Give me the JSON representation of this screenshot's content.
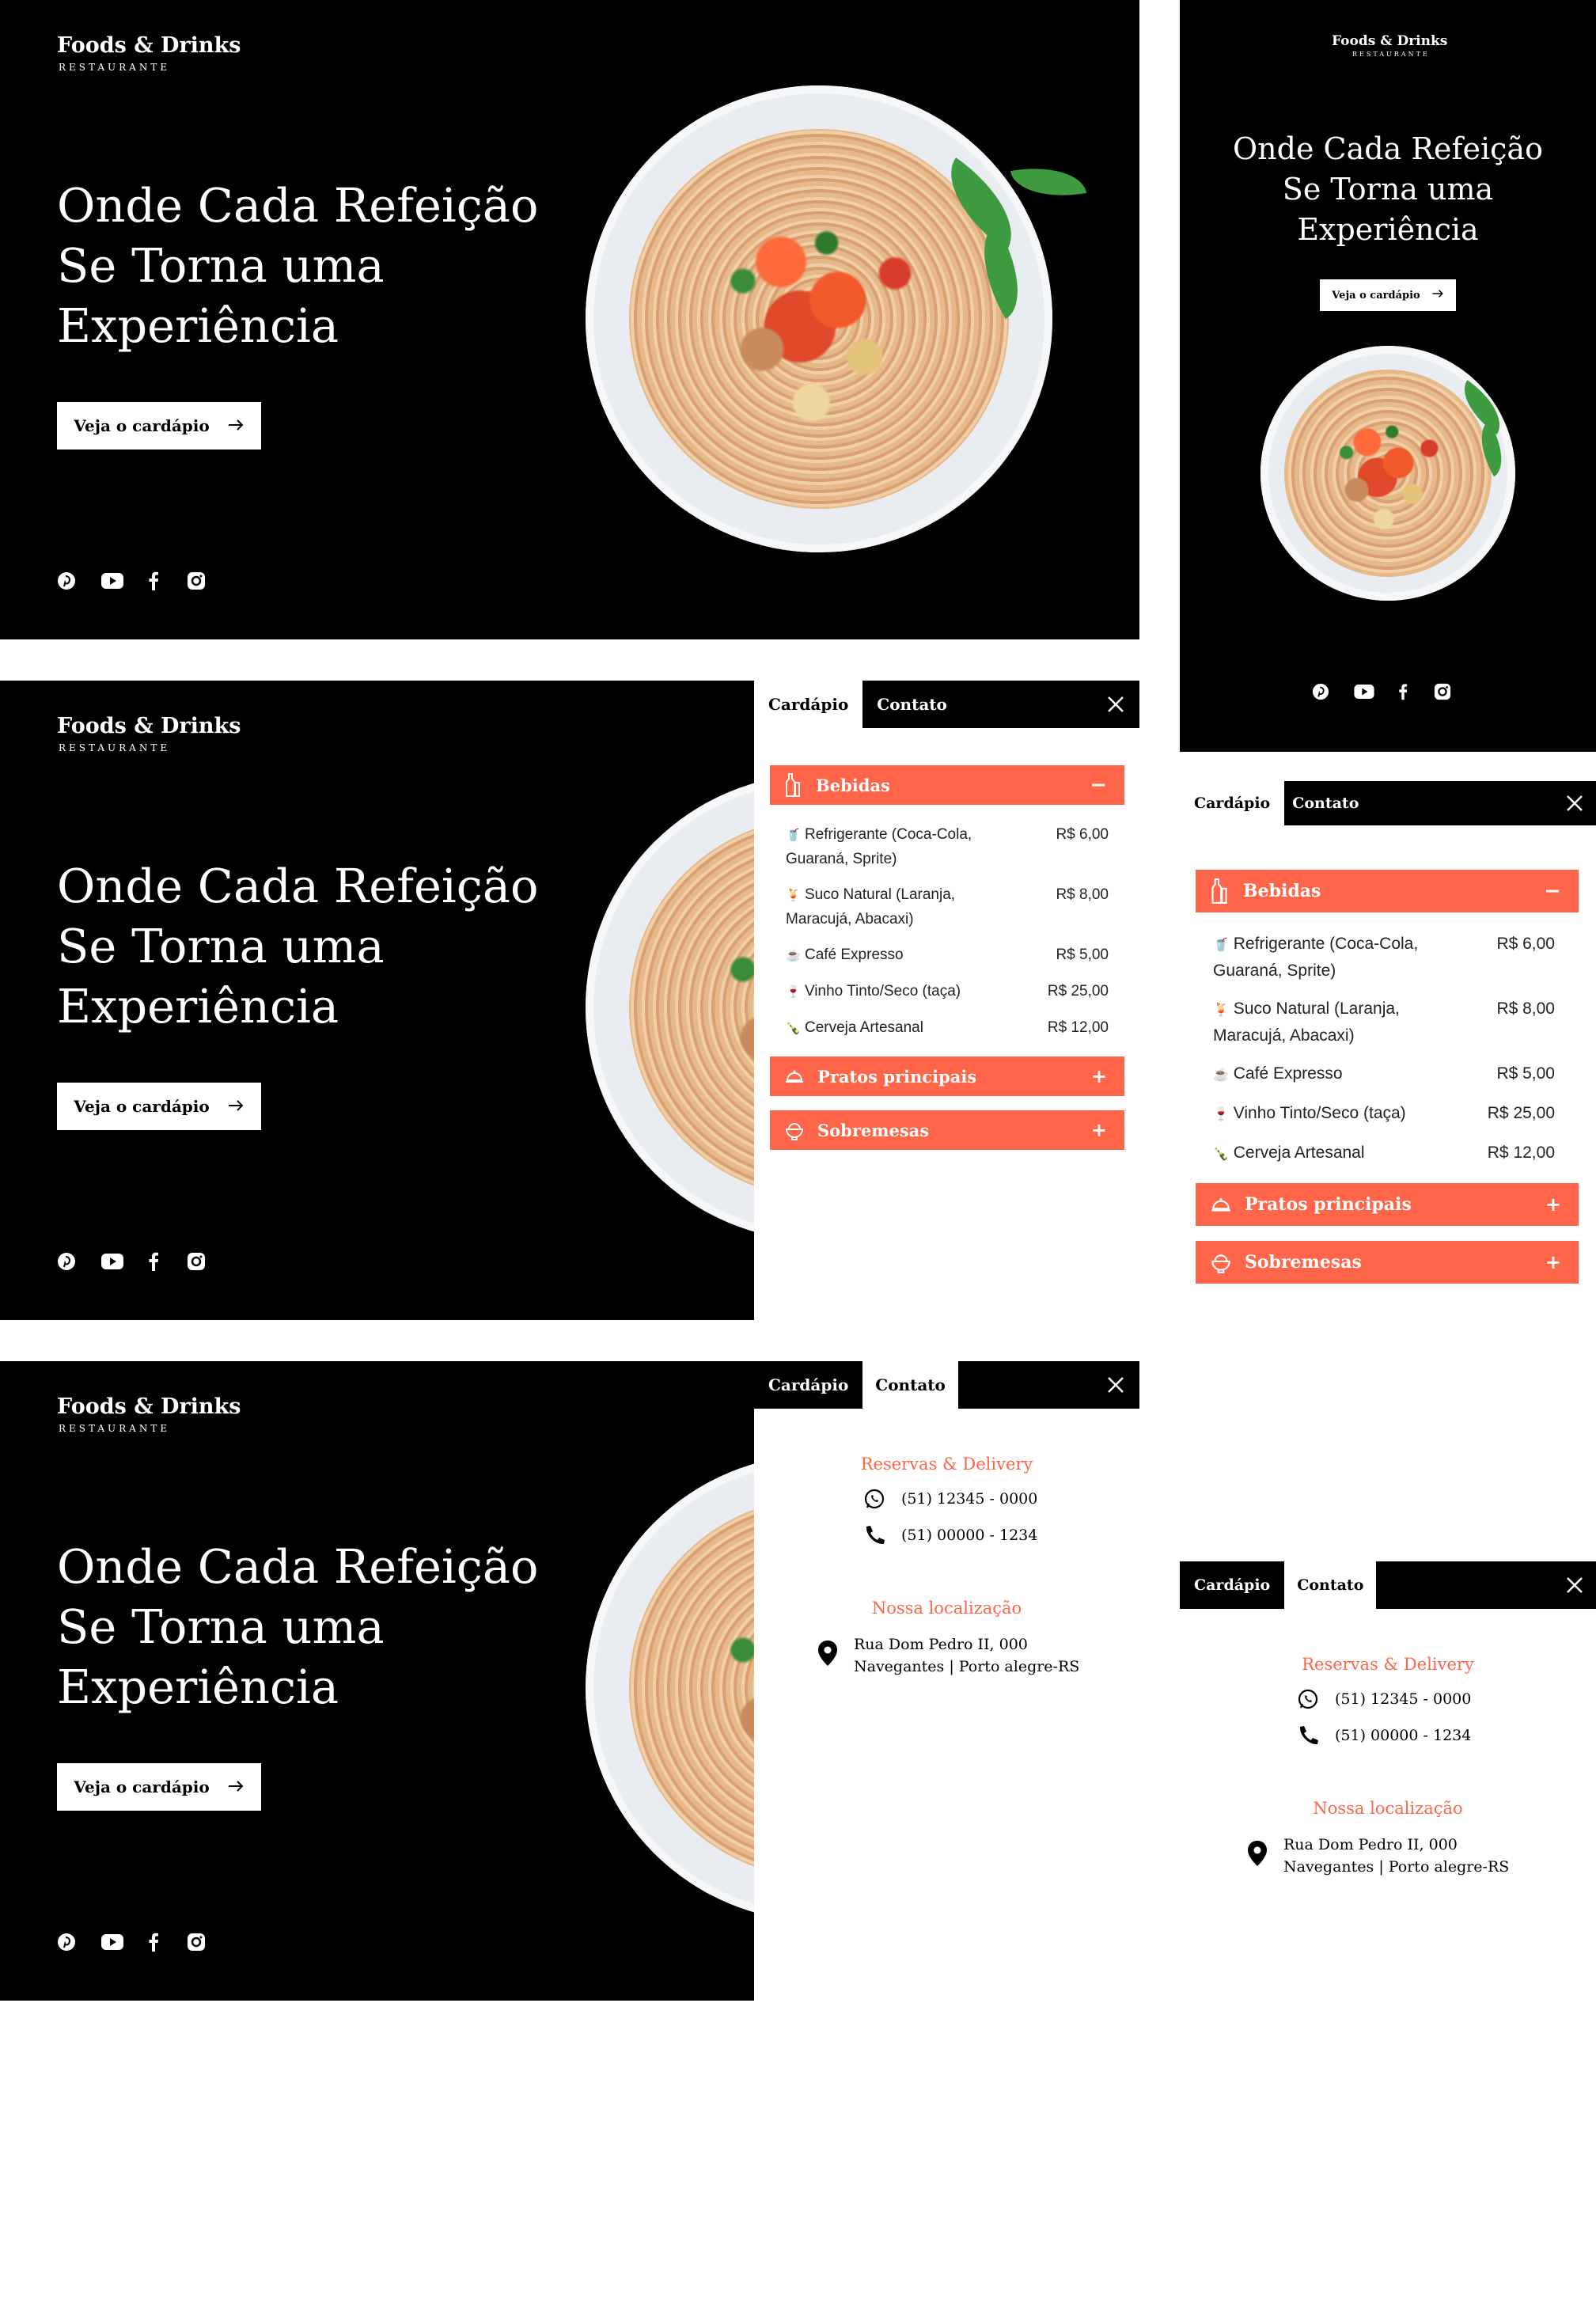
{
  "brand": {
    "name": "Foods & Drinks",
    "tagline": "RESTAURANTE"
  },
  "hero": {
    "title_lines": [
      "Onde Cada Refeição",
      "Se Torna uma",
      "Experiência"
    ],
    "cta_label": "Veja o cardápio",
    "cta_icon": "arrow-right-icon",
    "socials": [
      "pinterest-icon",
      "youtube-icon",
      "facebook-icon",
      "instagram-icon"
    ]
  },
  "tabs": {
    "menu": "Cardápio",
    "contact": "Contato",
    "close_icon": "close-icon"
  },
  "menu": {
    "categories": [
      {
        "name": "Bebidas",
        "icon": "bottle-icon",
        "state": "−"
      },
      {
        "name": "Pratos principais",
        "icon": "cloche-icon",
        "state": "+"
      },
      {
        "name": "Sobremesas",
        "icon": "ice-cream-icon",
        "state": "+"
      }
    ],
    "items": [
      {
        "emoji": "🥤",
        "name": "Refrigerante (Coca-Cola,",
        "name2": "Guaraná, Sprite)",
        "price": "R$ 6,00"
      },
      {
        "emoji": "🍹",
        "name": "Suco Natural (Laranja,",
        "name2": "Maracujá, Abacaxi)",
        "price": "R$ 8,00"
      },
      {
        "emoji": "☕",
        "name": "Café Expresso",
        "name2": "",
        "price": "R$ 5,00"
      },
      {
        "emoji": "🍷",
        "name": "Vinho Tinto/Seco (taça)",
        "name2": "",
        "price": "R$ 25,00"
      },
      {
        "emoji": "🍾",
        "name": "Cerveja Artesanal",
        "name2": "",
        "price": "R$ 12,00"
      }
    ]
  },
  "contact": {
    "reservations_title": "Reservas & Delivery",
    "whatsapp": "(51) 12345 - 0000",
    "phone": "(51) 00000 - 1234",
    "location_title": "Nossa localização",
    "address_line1": "Rua Dom Pedro II, 000",
    "address_line2": "Navegantes | Porto alegre-RS"
  },
  "colors": {
    "accent": "#ff6649",
    "background_dark": "#000000",
    "background_light": "#ffffff"
  }
}
